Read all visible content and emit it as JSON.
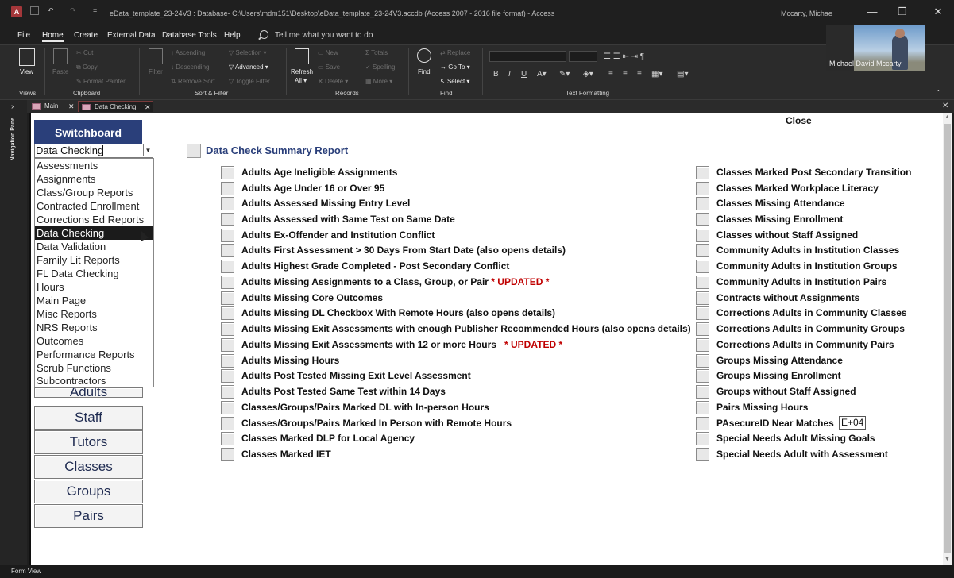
{
  "window": {
    "title": "eData_template_23-24V3 : Database- C:\\Users\\mdm151\\Desktop\\eData_template_23-24V3.accdb (Access 2007 - 2016 file format) - Access",
    "user": "Mccarty, Michae",
    "app_badge": "A"
  },
  "menu": {
    "items": [
      "File",
      "Home",
      "Create",
      "External Data",
      "Database Tools",
      "Help"
    ],
    "tellme": "Tell me what you want to do"
  },
  "ribbon": {
    "groups": [
      "Views",
      "Clipboard",
      "Sort & Filter",
      "Records",
      "Find",
      "Text Formatting"
    ],
    "view": "View",
    "paste": "Paste",
    "cut": "Cut",
    "copy": "Copy",
    "format_painter": "Format Painter",
    "filter": "Filter",
    "ascending": "Ascending",
    "descending": "Descending",
    "remove_sort": "Remove Sort",
    "selection": "Selection",
    "advanced": "Advanced",
    "toggle_filter": "Toggle Filter",
    "refresh": "Refresh",
    "refresh_all": "All",
    "new": "New",
    "save": "Save",
    "delete": "Delete",
    "totals": "Totals",
    "spelling": "Spelling",
    "more": "More",
    "find": "Find",
    "replace": "Replace",
    "goto": "Go To",
    "select": "Select",
    "bold": "B",
    "italic": "I",
    "underline": "U"
  },
  "webcam": {
    "name": "Michael David Mccarty"
  },
  "navpane": {
    "label": "Navigation Pane"
  },
  "tabs": [
    {
      "label": "Main"
    },
    {
      "label": "Data Checking"
    }
  ],
  "form": {
    "switchboard_title": "Switchboard",
    "close_label": "Close",
    "combo_value": "Data Checking",
    "dropdown_options": [
      "Assessments",
      "Assignments",
      "Class/Group Reports",
      "Contracted Enrollment",
      "Corrections Ed Reports",
      "Data Checking",
      "Data Validation",
      "Family Lit Reports",
      "FL Data Checking",
      "Hours",
      "Main Page",
      "Misc Reports",
      "NRS Reports",
      "Outcomes",
      "Performance Reports",
      "Scrub Functions",
      "Subcontractors"
    ],
    "selected_option": "Data Checking",
    "nav_buttons": [
      "Adults",
      "Staff",
      "Tutors",
      "Classes",
      "Groups",
      "Pairs"
    ],
    "section_title": "Data Check Summary Report",
    "left_items": [
      "Adults Age Ineligible Assignments",
      "Adults Age Under 16 or Over 95",
      "Adults Assessed Missing Entry Level",
      "Adults Assessed with Same Test on Same Date",
      "Adults Ex-Offender and Institution Conflict",
      "Adults First Assessment > 30 Days From Start Date (also opens details)",
      "Adults Highest Grade Completed - Post Secondary Conflict",
      "Adults Missing Assignments to a Class, Group, or Pair",
      "Adults Missing Core Outcomes",
      "Adults Missing DL Checkbox With Remote Hours (also opens details)",
      "Adults Missing Exit Assessments with enough Publisher Recommended Hours (also opens details)",
      "Adults Missing Exit Assessments with 12 or more Hours",
      "Adults Missing Hours",
      "Adults Post Tested Missing Exit Level Assessment",
      "Adults Post Tested Same Test within 14 Days",
      "Classes/Groups/Pairs Marked DL with In-person Hours",
      "Classes/Groups/Pairs Marked In Person with Remote Hours",
      "Classes Marked DLP for Local Agency",
      "Classes Marked IET"
    ],
    "updated_tag": "* UPDATED *",
    "right_items": [
      "Classes Marked Post Secondary Transition",
      "Classes Marked Workplace Literacy",
      "Classes Missing Attendance",
      "Classes Missing Enrollment",
      "Classes without Staff Assigned",
      "Community Adults in Institution Classes",
      "Community Adults in Institution Groups",
      "Community Adults in Institution Pairs",
      "Contracts without Assignments",
      "Corrections Adults in Community Classes",
      "Corrections Adults in Community Groups",
      "Corrections Adults in Community Pairs",
      "Groups Missing Attendance",
      "Groups Missing Enrollment",
      "Groups without Staff Assigned",
      "Pairs Missing Hours",
      "PAsecureID Near Matches",
      "Special Needs Adult Missing Goals",
      "Special Needs Adult with Assessment"
    ],
    "near_match_value": "E+04"
  },
  "status": {
    "view": "Form View"
  }
}
